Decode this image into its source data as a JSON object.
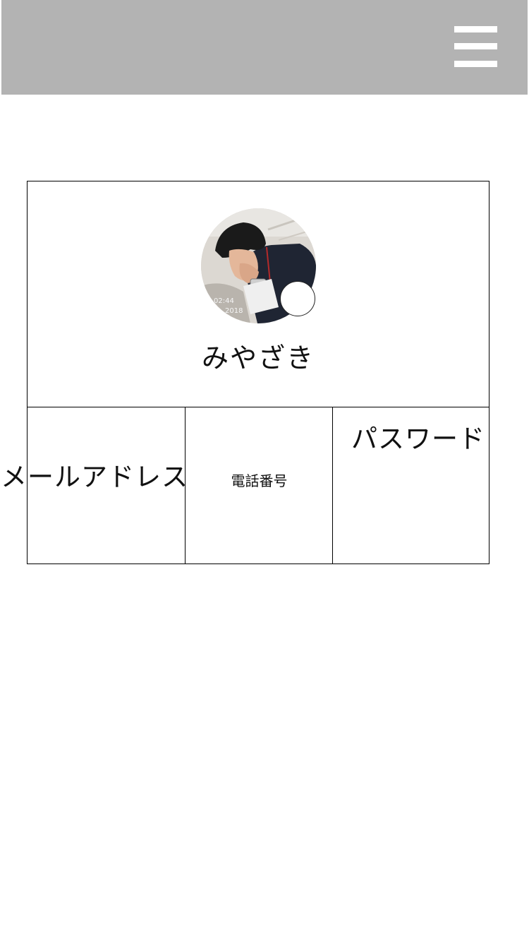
{
  "header": {
    "menu_icon": "hamburger-menu-icon",
    "background": "#b3b3b3"
  },
  "profile": {
    "avatar_icon": "profile-photo",
    "badge_icon": "edit-avatar-badge",
    "username": "みやざき"
  },
  "contact": {
    "email_label": "メールアドレス",
    "phone_label": "電話番号",
    "password_label": "パスワード"
  }
}
